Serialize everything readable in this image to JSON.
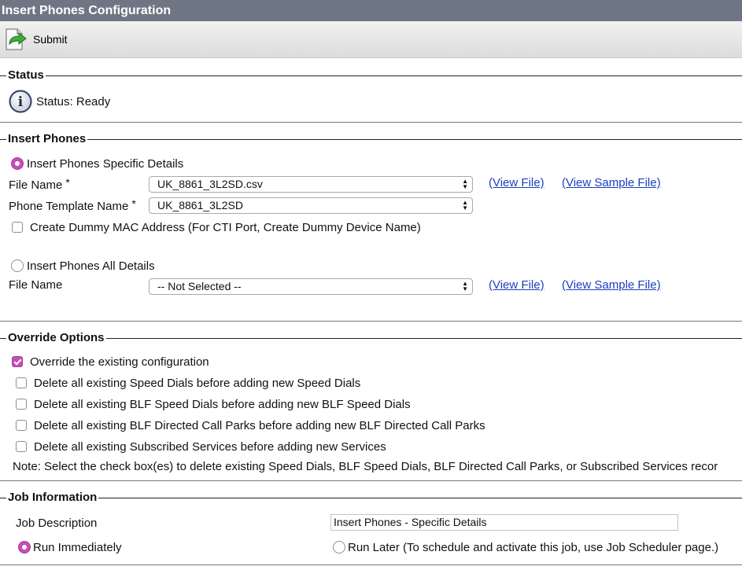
{
  "title": "Insert Phones Configuration",
  "toolbar": {
    "submit_label": "Submit",
    "submit_icon": "submit-arrow-icon"
  },
  "status": {
    "legend": "Status",
    "icon": "info-icon",
    "text": "Status: Ready"
  },
  "insert_phones": {
    "legend": "Insert Phones",
    "specific": {
      "radio_label": "Insert Phones Specific Details",
      "selected": true,
      "file_name_label": "File Name",
      "file_name_value": "UK_8861_3L2SD.csv",
      "template_label": "Phone Template Name",
      "template_value": "UK_8861_3L2SD",
      "required_mark": "*",
      "dummy_mac_label": "Create Dummy MAC Address (For CTI Port, Create Dummy Device Name)",
      "dummy_mac_checked": false,
      "view_file": "(View File)",
      "view_sample_file": "(View Sample File)"
    },
    "all": {
      "radio_label": "Insert Phones All Details",
      "selected": false,
      "file_name_label": "File Name",
      "file_name_value": "-- Not Selected --",
      "view_file": "(View File)",
      "view_sample_file": "(View Sample File)"
    }
  },
  "override": {
    "legend": "Override Options",
    "options": [
      {
        "label": "Override the existing configuration",
        "checked": true
      },
      {
        "label": "Delete all existing Speed Dials before adding new Speed Dials",
        "checked": false
      },
      {
        "label": "Delete all existing BLF Speed Dials before adding new BLF Speed Dials",
        "checked": false
      },
      {
        "label": "Delete all existing BLF Directed Call Parks before adding new BLF Directed Call Parks",
        "checked": false
      },
      {
        "label": "Delete all existing Subscribed Services before adding new Services",
        "checked": false
      }
    ],
    "note": "Note: Select the check box(es) to delete existing Speed Dials, BLF Speed Dials, BLF Directed Call Parks, or Subscribed Services recor"
  },
  "job": {
    "legend": "Job Information",
    "description_label": "Job Description",
    "description_value": "Insert Phones - Specific Details",
    "run_immediately": "Run Immediately",
    "run_immediately_selected": true,
    "run_later": "Run Later (To schedule and activate this job, use Job Scheduler page.)",
    "run_later_selected": false
  },
  "colors": {
    "accent": "#c34fb8",
    "link": "#1a3fbf",
    "title_bar": "#6f7683"
  }
}
